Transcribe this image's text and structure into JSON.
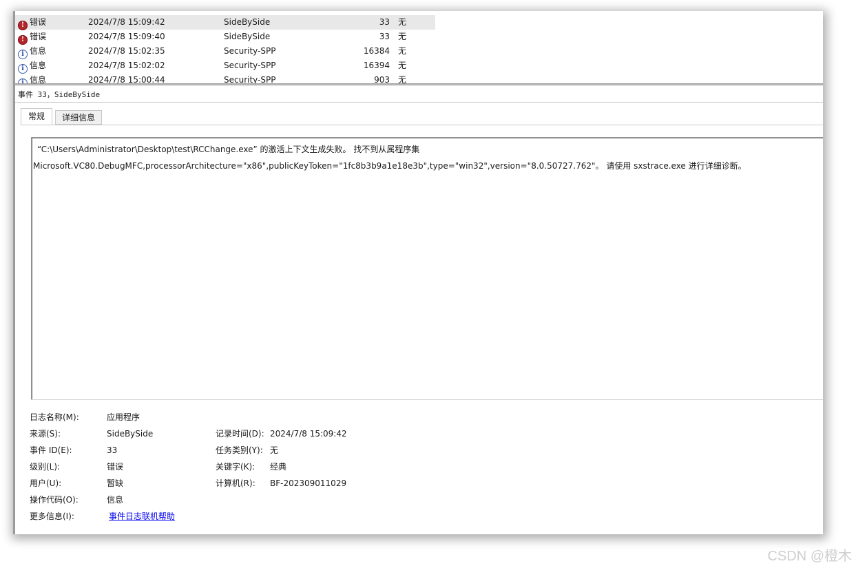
{
  "event_list": {
    "rows": [
      {
        "level": "错误",
        "level_icon": "error-icon",
        "date": "2024/7/8 15:09:42",
        "source": "SideBySide",
        "event_id": "33",
        "task": "无",
        "selected": true
      },
      {
        "level": "错误",
        "level_icon": "error-icon",
        "date": "2024/7/8 15:09:40",
        "source": "SideBySide",
        "event_id": "33",
        "task": "无",
        "selected": false
      },
      {
        "level": "信息",
        "level_icon": "info-icon",
        "date": "2024/7/8 15:02:35",
        "source": "Security-SPP",
        "event_id": "16384",
        "task": "无",
        "selected": false
      },
      {
        "level": "信息",
        "level_icon": "info-icon",
        "date": "2024/7/8 15:02:02",
        "source": "Security-SPP",
        "event_id": "16394",
        "task": "无",
        "selected": false
      },
      {
        "level": "信息",
        "level_icon": "info-icon",
        "date": "2024/7/8 15:00:44",
        "source": "Security-SPP",
        "event_id": "903",
        "task": "无",
        "selected": false
      }
    ]
  },
  "detail": {
    "header": "事件 33，SideBySide",
    "tabs": {
      "general": "常规",
      "details": "详细信息"
    },
    "description_line1": "“C:\\Users\\Administrator\\Desktop\\test\\RCChange.exe” 的激活上下文生成失败。 找不到从属程序集",
    "description_line2": "Microsoft.VC80.DebugMFC,processorArchitecture=\"x86\",publicKeyToken=\"1fc8b3b9a1e18e3b\",type=\"win32\",version=\"8.0.50727.762\"。 请使用 sxstrace.exe 进行详细诊断。"
  },
  "properties": {
    "log_name_label": "日志名称(M):",
    "log_name_value": "应用程序",
    "source_label": "来源(S):",
    "source_value": "SideBySide",
    "logged_label": "记录时间(D):",
    "logged_value": "2024/7/8 15:09:42",
    "event_id_label": "事件 ID(E):",
    "event_id_value": "33",
    "task_category_label": "任务类别(Y):",
    "task_category_value": "无",
    "level_label": "级别(L):",
    "level_value": "错误",
    "keywords_label": "关键字(K):",
    "keywords_value": "经典",
    "user_label": "用户(U):",
    "user_value": "暂缺",
    "computer_label": "计算机(R):",
    "computer_value": "BF-202309011029",
    "opcode_label": "操作代码(O):",
    "opcode_value": "信息",
    "more_info_label": "更多信息(I):",
    "more_info_link": "事件日志联机帮助"
  },
  "watermark": "CSDN @橙木"
}
